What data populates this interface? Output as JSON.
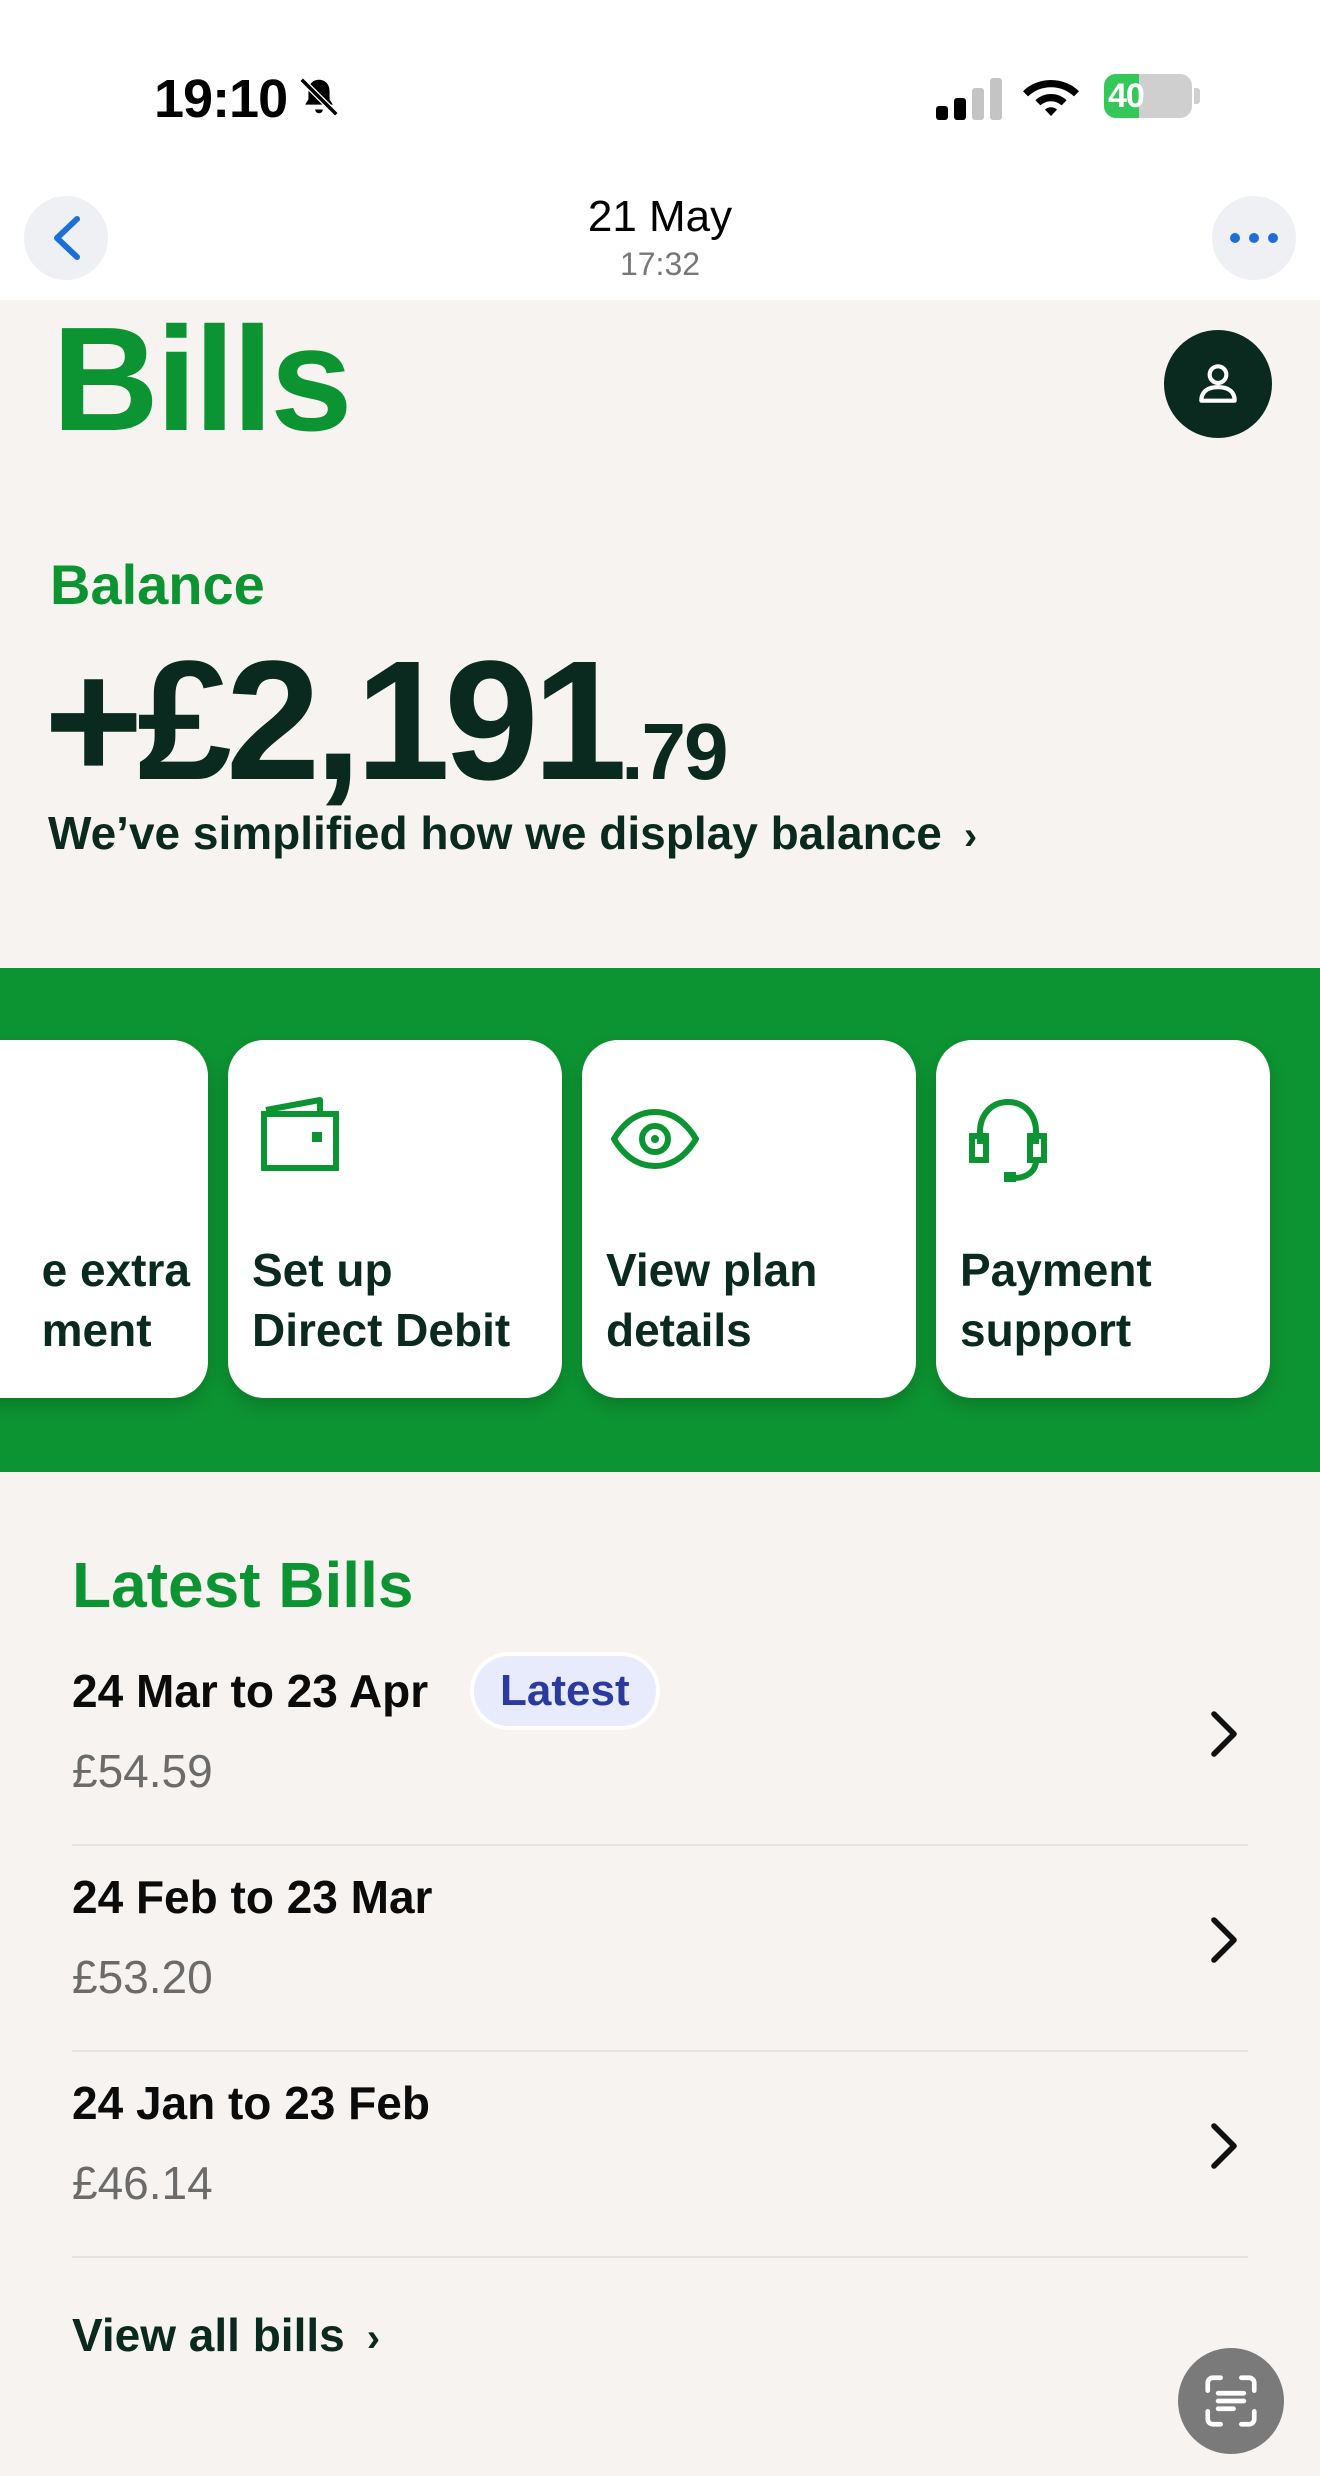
{
  "status_bar": {
    "time": "19:10",
    "battery": "40",
    "battery_level": 0.4
  },
  "header": {
    "date": "21 May",
    "time": "17:32"
  },
  "page": {
    "title": "Bills"
  },
  "balance": {
    "label": "Balance",
    "amount_main": "+£2,191",
    "amount_pence": ".79",
    "note": "We’ve simplified how we display balance",
    "note_chevron": "›"
  },
  "actions": [
    {
      "label": "e extra\nment",
      "icon": "card-icon"
    },
    {
      "label": "Set up\nDirect Debit",
      "icon": "wallet-icon"
    },
    {
      "label": "View plan\ndetails",
      "icon": "eye-icon"
    },
    {
      "label": "Payment\nsupport",
      "icon": "headset-icon"
    }
  ],
  "latest_bills": {
    "title": "Latest Bills",
    "badge": "Latest",
    "items": [
      {
        "period": "24 Mar to 23 Apr",
        "amount": "£54.59"
      },
      {
        "period": "24 Feb to 23 Mar",
        "amount": "£53.20"
      },
      {
        "period": "24 Jan to 23 Feb",
        "amount": "£46.14"
      }
    ],
    "view_all": "View all bills",
    "view_all_chevron": "›"
  },
  "colors": {
    "brand_green": "#0d9432",
    "dark": "#0b2a1f",
    "badge_blue": "#2a3aa0",
    "background": "#f6f3f0"
  }
}
